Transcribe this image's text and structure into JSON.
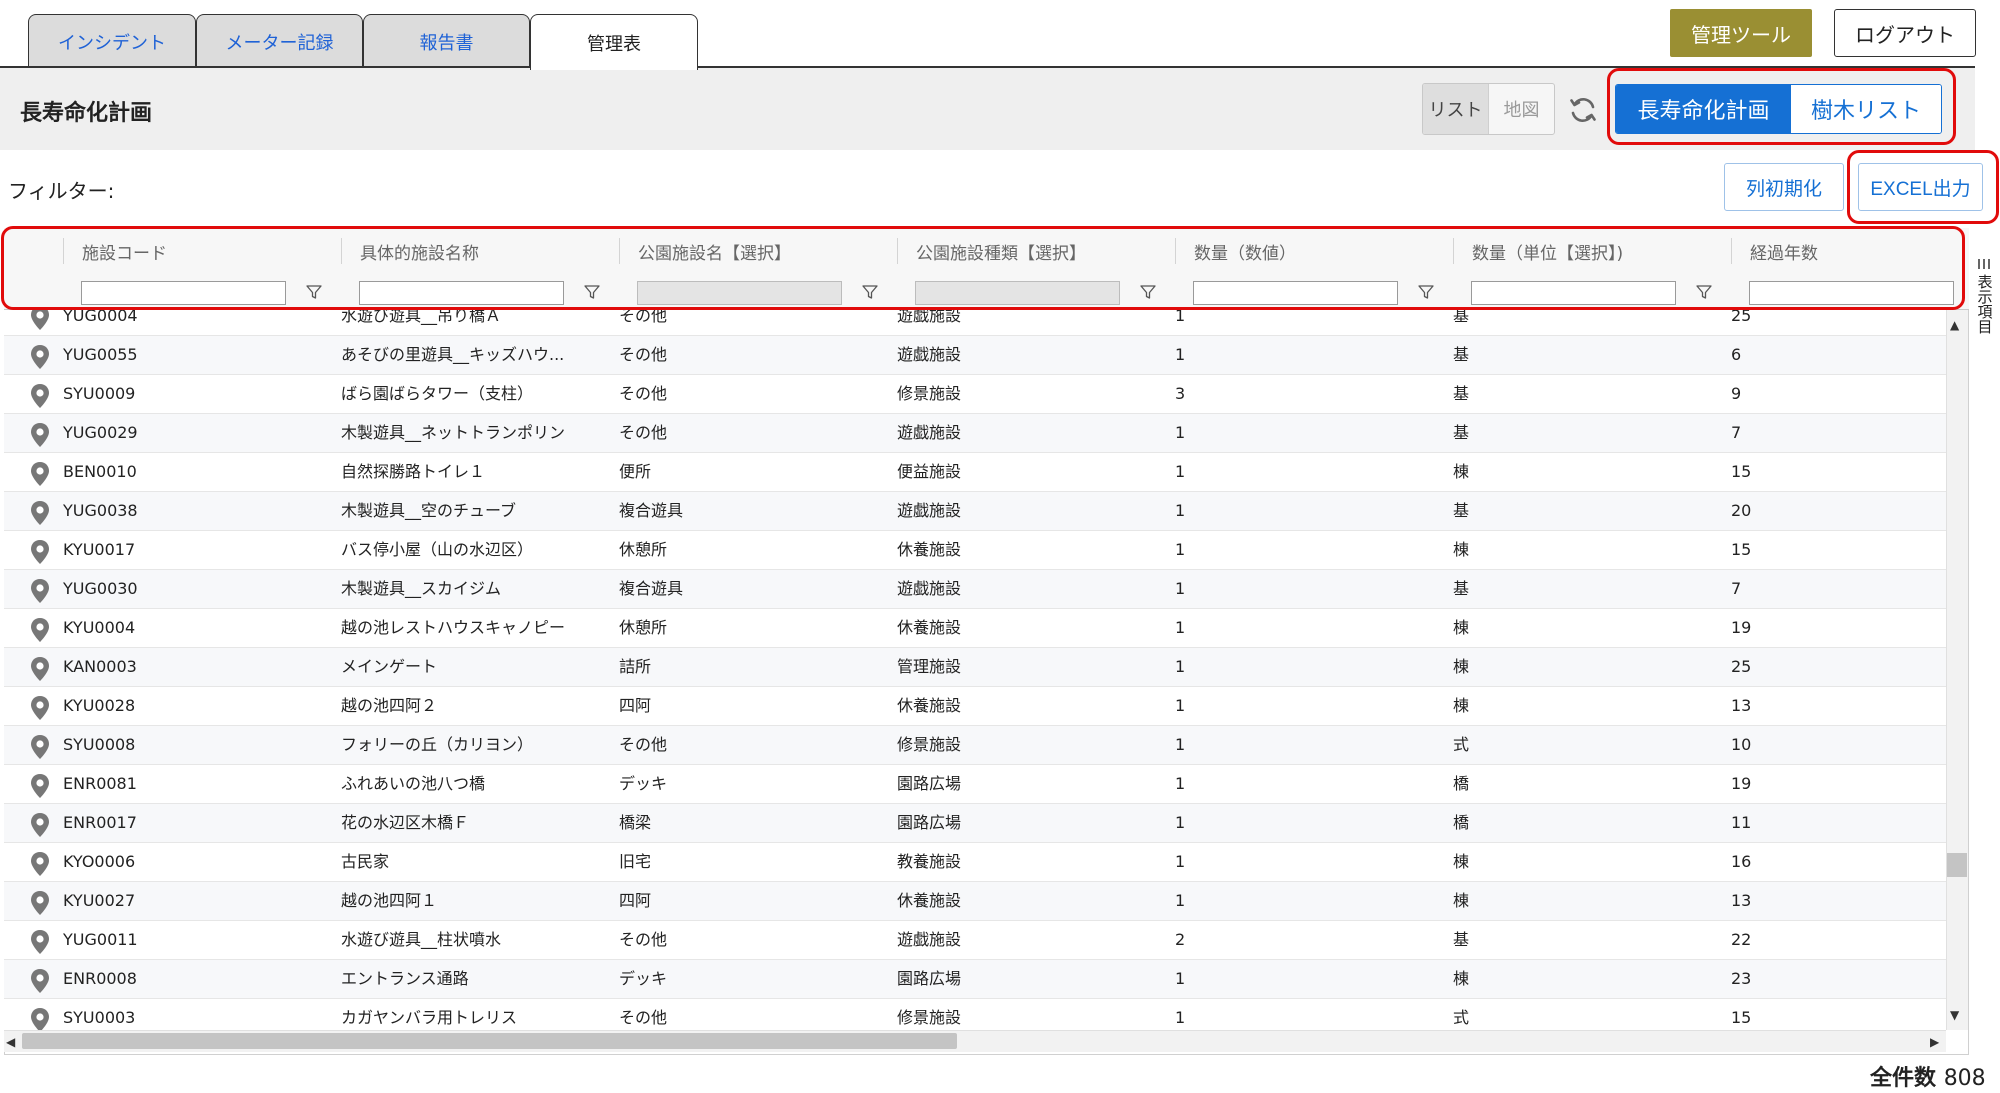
{
  "tabs": [
    {
      "label": "インシデント"
    },
    {
      "label": "メーター記録"
    },
    {
      "label": "報告書"
    },
    {
      "label": "管理表"
    }
  ],
  "top_buttons": {
    "admin": "管理ツール",
    "logout": "ログアウト"
  },
  "header": {
    "title": "長寿命化計画",
    "view_list": "リスト",
    "view_map": "地図",
    "mode_selected": "長寿命化計画",
    "mode_other": "樹木リスト"
  },
  "filter": {
    "label": "フィルター:",
    "reset_columns": "列初期化",
    "excel_export": "EXCEL出力"
  },
  "columns": [
    "施設コード",
    "具体的施設名称",
    "公園施設名【選択】",
    "公園施設種類【選択】",
    "数量（数値）",
    "数量（単位【選択】)",
    "経過年数"
  ],
  "rows": [
    [
      "YUG0004",
      "水遊び遊具__吊り橋Ａ",
      "その他",
      "遊戯施設",
      "1",
      "基",
      "25"
    ],
    [
      "YUG0055",
      "あそびの里遊具__キッズハウ...",
      "その他",
      "遊戯施設",
      "1",
      "基",
      "6"
    ],
    [
      "SYU0009",
      "ばら園ばらタワー（支柱）",
      "その他",
      "修景施設",
      "3",
      "基",
      "9"
    ],
    [
      "YUG0029",
      "木製遊具__ネットトランポリン",
      "その他",
      "遊戯施設",
      "1",
      "基",
      "7"
    ],
    [
      "BEN0010",
      "自然探勝路トイレ１",
      "便所",
      "便益施設",
      "1",
      "棟",
      "15"
    ],
    [
      "YUG0038",
      "木製遊具__空のチューブ",
      "複合遊具",
      "遊戯施設",
      "1",
      "基",
      "20"
    ],
    [
      "KYU0017",
      "バス停小屋（山の水辺区）",
      "休憩所",
      "休養施設",
      "1",
      "棟",
      "15"
    ],
    [
      "YUG0030",
      "木製遊具__スカイジム",
      "複合遊具",
      "遊戯施設",
      "1",
      "基",
      "7"
    ],
    [
      "KYU0004",
      "越の池レストハウスキャノピー",
      "休憩所",
      "休養施設",
      "1",
      "棟",
      "19"
    ],
    [
      "KAN0003",
      "メインゲート",
      "詰所",
      "管理施設",
      "1",
      "棟",
      "25"
    ],
    [
      "KYU0028",
      "越の池四阿２",
      "四阿",
      "休養施設",
      "1",
      "棟",
      "13"
    ],
    [
      "SYU0008",
      "フォリーの丘（カリヨン）",
      "その他",
      "修景施設",
      "1",
      "式",
      "10"
    ],
    [
      "ENR0081",
      "ふれあいの池八つ橋",
      "デッキ",
      "園路広場",
      "1",
      "橋",
      "19"
    ],
    [
      "ENR0017",
      "花の水辺区木橋Ｆ",
      "橋梁",
      "園路広場",
      "1",
      "橋",
      "11"
    ],
    [
      "KYO0006",
      "古民家",
      "旧宅",
      "教養施設",
      "1",
      "棟",
      "16"
    ],
    [
      "KYU0027",
      "越の池四阿１",
      "四阿",
      "休養施設",
      "1",
      "棟",
      "13"
    ],
    [
      "YUG0011",
      "水遊び遊具__柱状噴水",
      "その他",
      "遊戯施設",
      "2",
      "基",
      "22"
    ],
    [
      "ENR0008",
      "エントランス通路",
      "デッキ",
      "園路広場",
      "1",
      "棟",
      "23"
    ],
    [
      "SYU0003",
      "カガヤンバラ用トレリス",
      "その他",
      "修景施設",
      "1",
      "式",
      "15"
    ]
  ],
  "side_panel_label": "表示項目",
  "footer": {
    "total_label": "全件数",
    "total_count": "808"
  },
  "colors": {
    "accent_blue": "#1570d4",
    "admin_olive": "#9a8f33",
    "highlight_red": "#e10b0b"
  }
}
